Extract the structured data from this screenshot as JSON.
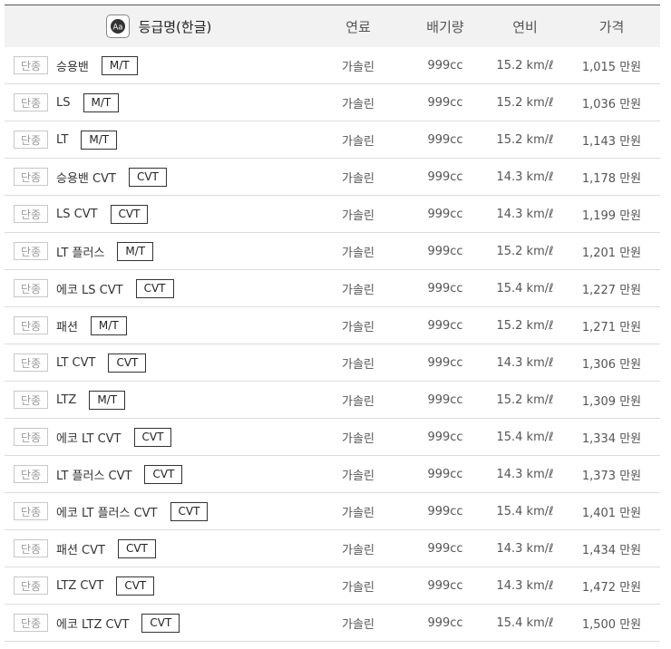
{
  "header": {
    "name_label": "등급명(한글)",
    "fuel_label": "연료",
    "displacement_label": "배기량",
    "efficiency_label": "연비",
    "price_label": "가격",
    "icon": "text-aa-icon"
  },
  "rows": [
    {
      "badge": "단종",
      "trim": "승용밴",
      "trans": "M/T",
      "fuel": "가솔린",
      "disp": "999cc",
      "eff": "15.2 km/ℓ",
      "price": "1,015 만원"
    },
    {
      "badge": "단종",
      "trim": "LS",
      "trans": "M/T",
      "fuel": "가솔린",
      "disp": "999cc",
      "eff": "15.2 km/ℓ",
      "price": "1,036 만원"
    },
    {
      "badge": "단종",
      "trim": "LT",
      "trans": "M/T",
      "fuel": "가솔린",
      "disp": "999cc",
      "eff": "15.2 km/ℓ",
      "price": "1,143 만원"
    },
    {
      "badge": "단종",
      "trim": "승용밴 CVT",
      "trans": "CVT",
      "fuel": "가솔린",
      "disp": "999cc",
      "eff": "14.3 km/ℓ",
      "price": "1,178 만원"
    },
    {
      "badge": "단종",
      "trim": "LS CVT",
      "trans": "CVT",
      "fuel": "가솔린",
      "disp": "999cc",
      "eff": "14.3 km/ℓ",
      "price": "1,199 만원"
    },
    {
      "badge": "단종",
      "trim": "LT 플러스",
      "trans": "M/T",
      "fuel": "가솔린",
      "disp": "999cc",
      "eff": "15.2 km/ℓ",
      "price": "1,201 만원"
    },
    {
      "badge": "단종",
      "trim": "에코 LS CVT",
      "trans": "CVT",
      "fuel": "가솔린",
      "disp": "999cc",
      "eff": "15.4 km/ℓ",
      "price": "1,227 만원"
    },
    {
      "badge": "단종",
      "trim": "패션",
      "trans": "M/T",
      "fuel": "가솔린",
      "disp": "999cc",
      "eff": "15.2 km/ℓ",
      "price": "1,271 만원"
    },
    {
      "badge": "단종",
      "trim": "LT CVT",
      "trans": "CVT",
      "fuel": "가솔린",
      "disp": "999cc",
      "eff": "14.3 km/ℓ",
      "price": "1,306 만원"
    },
    {
      "badge": "단종",
      "trim": "LTZ",
      "trans": "M/T",
      "fuel": "가솔린",
      "disp": "999cc",
      "eff": "15.2 km/ℓ",
      "price": "1,309 만원"
    },
    {
      "badge": "단종",
      "trim": "에코 LT CVT",
      "trans": "CVT",
      "fuel": "가솔린",
      "disp": "999cc",
      "eff": "15.4 km/ℓ",
      "price": "1,334 만원"
    },
    {
      "badge": "단종",
      "trim": "LT 플러스 CVT",
      "trans": "CVT",
      "fuel": "가솔린",
      "disp": "999cc",
      "eff": "14.3 km/ℓ",
      "price": "1,373 만원"
    },
    {
      "badge": "단종",
      "trim": "에코 LT 플러스 CVT",
      "trans": "CVT",
      "fuel": "가솔린",
      "disp": "999cc",
      "eff": "15.4 km/ℓ",
      "price": "1,401 만원"
    },
    {
      "badge": "단종",
      "trim": "패션 CVT",
      "trans": "CVT",
      "fuel": "가솔린",
      "disp": "999cc",
      "eff": "14.3 km/ℓ",
      "price": "1,434 만원"
    },
    {
      "badge": "단종",
      "trim": "LTZ CVT",
      "trans": "CVT",
      "fuel": "가솔린",
      "disp": "999cc",
      "eff": "14.3 km/ℓ",
      "price": "1,472 만원"
    },
    {
      "badge": "단종",
      "trim": "에코 LTZ CVT",
      "trans": "CVT",
      "fuel": "가솔린",
      "disp": "999cc",
      "eff": "15.4 km/ℓ",
      "price": "1,500 만원"
    }
  ]
}
